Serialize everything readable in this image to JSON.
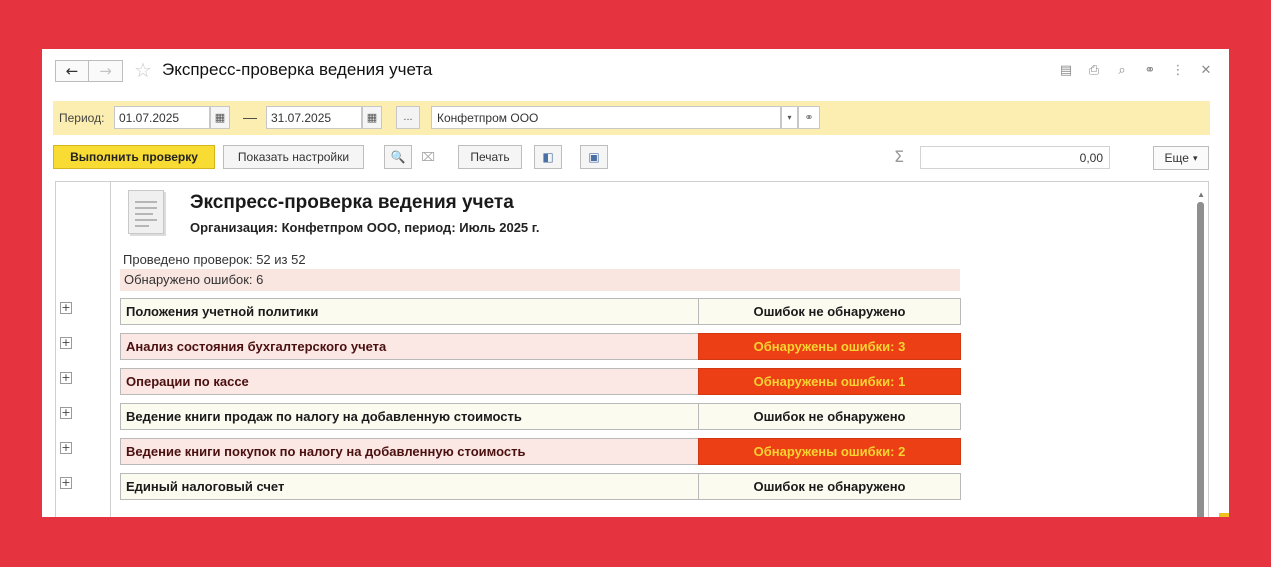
{
  "window": {
    "title": "Экспресс-проверка ведения учета",
    "back_icon": "←",
    "forward_icon": "→",
    "star_icon": "☆",
    "icons": [
      "document-icon",
      "print-icon",
      "preview-icon",
      "link-icon",
      "more-icon",
      "close-icon"
    ],
    "icon_glyphs": [
      "▤",
      "⎙",
      "⌕",
      "⚭",
      "⋮",
      "✕"
    ]
  },
  "period": {
    "label": "Период:",
    "from": "01.07.2025",
    "to": "31.07.2025",
    "dash": "—",
    "dots": "...",
    "organization": "Конфетпром ООО",
    "calendar_glyph": "▦",
    "dropdown_glyph": "▾",
    "link_glyph": "⚭"
  },
  "toolbar": {
    "run_label": "Выполнить проверку",
    "settings_label": "Показать настройки",
    "search_glyph": "🔍",
    "search_clear_glyph": "⌧",
    "print_label": "Печать",
    "preview_glyph": "◧",
    "save_glyph": "▣",
    "sigma": "Σ",
    "sum_value": "0,00",
    "more_label": "Еще",
    "more_arrow": "▾"
  },
  "report": {
    "title": "Экспресс-проверка ведения учета",
    "subtitle": "Организация: Конфетпром ООО, период: Июль 2025 г.",
    "checks_done": "Проведено проверок: 52 из 52",
    "errors_found": "Обнаружено ошибок: 6",
    "expand_glyph": "+",
    "rows": [
      {
        "name": "Положения учетной политики",
        "status": "Ошибок не обнаружено",
        "state": "ok"
      },
      {
        "name": "Анализ состояния бухгалтерского учета",
        "status": "Обнаружены ошибки: 3",
        "state": "err"
      },
      {
        "name": "Операции по кассе",
        "status": "Обнаружены ошибки: 1",
        "state": "err"
      },
      {
        "name": "Ведение книги продаж по налогу на добавленную стоимость",
        "status": "Ошибок не обнаружено",
        "state": "ok"
      },
      {
        "name": "Ведение книги покупок по налогу на добавленную стоимость",
        "status": "Обнаружены ошибки: 2",
        "state": "err"
      },
      {
        "name": "Единый налоговый счет",
        "status": "Ошибок не обнаружено",
        "state": "ok"
      }
    ]
  },
  "colors": {
    "background": "#e5343f",
    "period_bar": "#fbeeb0",
    "primary_button": "#f8dc33",
    "error_cell": "#ec3f16",
    "error_text": "#f8d430"
  }
}
